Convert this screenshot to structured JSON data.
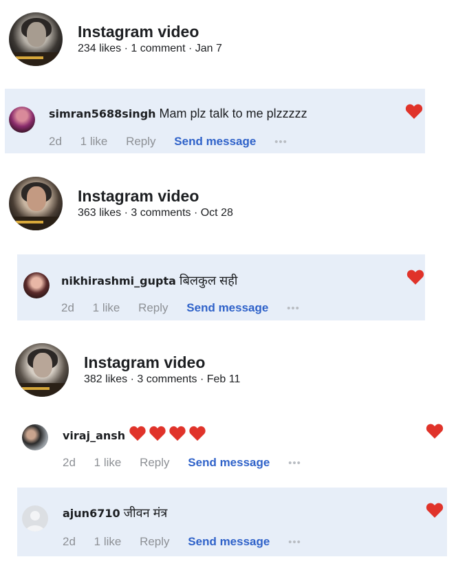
{
  "posts": [
    {
      "title": "Instagram video",
      "meta": "234 likes · 1 comment · Jan 7",
      "comments": [
        {
          "user": "simran5688singh",
          "text": "Mam plz talk to me plzzzzz",
          "time": "2d",
          "likes": "1 like",
          "reply": "Reply",
          "send": "Send message",
          "more": "•••"
        }
      ]
    },
    {
      "title": "Instagram video",
      "meta": "363 likes · 3 comments · Oct 28",
      "comments": [
        {
          "user": "nikhirashmi_gupta",
          "text": "बिलकुल सही",
          "time": "2d",
          "likes": "1 like",
          "reply": "Reply",
          "send": "Send message",
          "more": "•••"
        }
      ]
    },
    {
      "title": "Instagram video",
      "meta": "382 likes · 3 comments · Feb 11",
      "comments": [
        {
          "user": "viraj_ansh",
          "text": "",
          "emoji": "❤❤❤❤",
          "time": "2d",
          "likes": "1 like",
          "reply": "Reply",
          "send": "Send message",
          "more": "•••"
        },
        {
          "user": "ajun6710",
          "text": "जीवन मंत्र",
          "time": "2d",
          "likes": "1 like",
          "reply": "Reply",
          "send": "Send message",
          "more": "•••"
        }
      ]
    }
  ],
  "colors": {
    "comment_bg": "#e7eef8",
    "link_blue": "#2f62c9",
    "heart_red": "#e0332a",
    "muted": "#8d9095"
  },
  "icons": {
    "liked": "heart-icon",
    "more": "more-icon"
  }
}
